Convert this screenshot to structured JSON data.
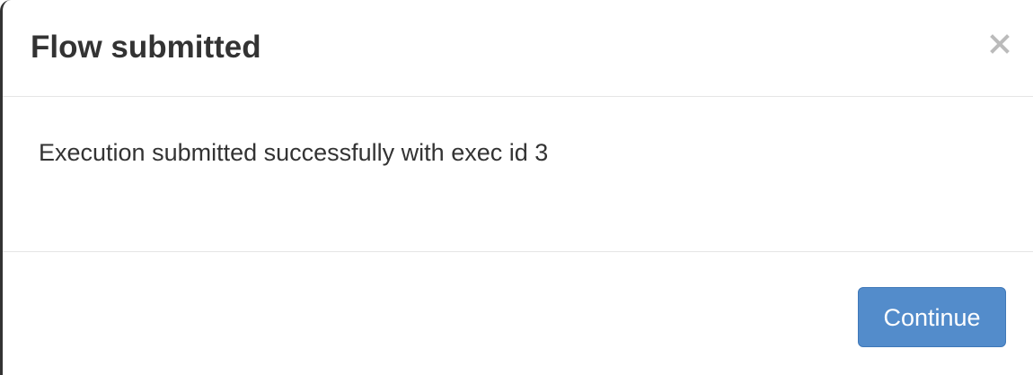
{
  "dialog": {
    "title": "Flow submitted",
    "close_icon": "close-icon",
    "message": "Execution submitted successfully with exec id 3",
    "continue_label": "Continue"
  },
  "colors": {
    "primary_button": "#538ccb",
    "title_text": "#333333",
    "close_icon": "#bbbbbb",
    "divider": "#e5e5e5"
  }
}
